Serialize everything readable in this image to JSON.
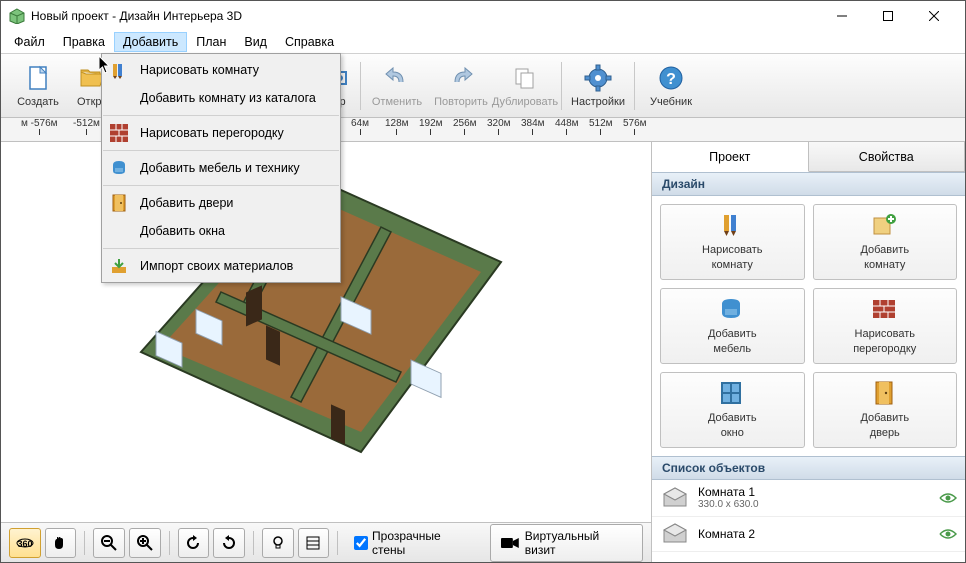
{
  "window": {
    "title": "Новый проект - Дизайн Интерьера 3D"
  },
  "menus": {
    "file": "Файл",
    "edit": "Правка",
    "add": "Добавить",
    "plan": "План",
    "view": "Вид",
    "help": "Справка"
  },
  "dropdown": {
    "draw_room": "Нарисовать комнату",
    "add_room_catalog": "Добавить комнату из каталога",
    "draw_partition": "Нарисовать перегородку",
    "add_furniture": "Добавить мебель и технику",
    "add_doors": "Добавить двери",
    "add_windows": "Добавить окна",
    "import_materials": "Импорт своих материалов"
  },
  "toolbar": {
    "create": "Создать",
    "open": "Откр",
    "view_partial": "тр",
    "undo": "Отменить",
    "redo": "Повторить",
    "duplicate": "Дублировать",
    "settings": "Настройки",
    "tutorial": "Учебник"
  },
  "ruler": {
    "ticks": [
      "м -576м",
      "-512м",
      "64м",
      "128м",
      "192м",
      "256м",
      "320м",
      "384м",
      "448м",
      "512м",
      "576м"
    ]
  },
  "bottombar": {
    "transparent_walls": "Прозрачные стены",
    "virtual_visit": "Виртуальный визит"
  },
  "rightpanel": {
    "tab_project": "Проект",
    "tab_properties": "Свойства",
    "section_design": "Дизайн",
    "cards": {
      "draw_room_l1": "Нарисовать",
      "draw_room_l2": "комнату",
      "add_room_l1": "Добавить",
      "add_room_l2": "комнату",
      "add_furniture_l1": "Добавить",
      "add_furniture_l2": "мебель",
      "draw_partition_l1": "Нарисовать",
      "draw_partition_l2": "перегородку",
      "add_window_l1": "Добавить",
      "add_window_l2": "окно",
      "add_door_l1": "Добавить",
      "add_door_l2": "дверь"
    },
    "section_objects": "Список объектов",
    "objects": [
      {
        "name": "Комната 1",
        "dims": "330.0 x 630.0"
      },
      {
        "name": "Комната 2",
        "dims": ""
      }
    ]
  }
}
